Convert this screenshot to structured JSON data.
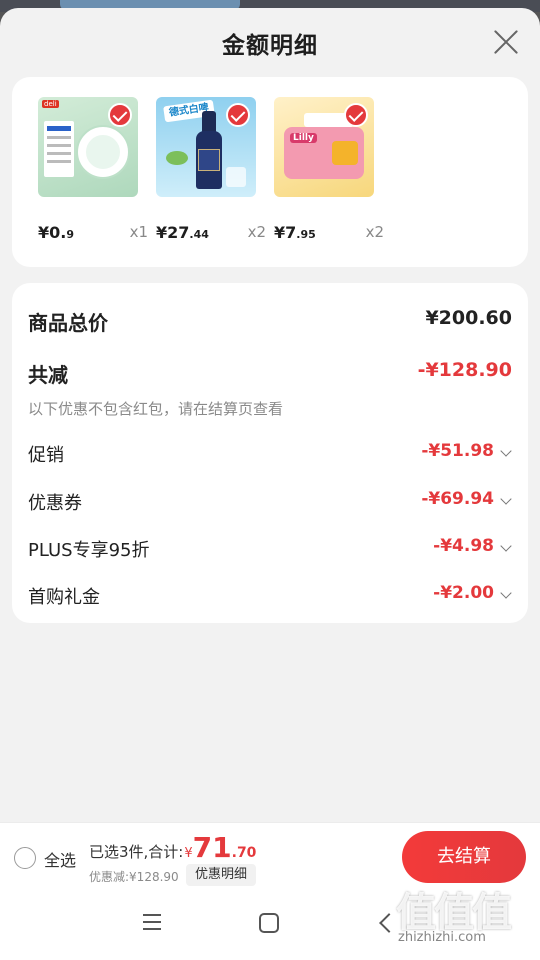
{
  "sheet": {
    "title": "金额明细"
  },
  "products": [
    {
      "price_main": "¥0.",
      "price_dec": "9",
      "qty": "x1",
      "thumb_text": "deli",
      "name": "tape"
    },
    {
      "price_main": "¥27",
      "price_dec": ".44",
      "qty": "x2",
      "thumb_text": "德式白啤",
      "name": "beer"
    },
    {
      "price_main": "¥7",
      "price_dec": ".95",
      "qty": "x2",
      "thumb_text": "Lilly",
      "name": "snack"
    }
  ],
  "details": {
    "total_label": "商品总价",
    "total_value": "¥200.60",
    "reduce_label": "共减",
    "reduce_value": "-¥128.90",
    "reduce_note": "以下优惠不包含红包，请在结算页查看",
    "items": [
      {
        "label": "促销",
        "value": "-¥51.98"
      },
      {
        "label": "优惠券",
        "value": "-¥69.94"
      },
      {
        "label": "PLUS专享95折",
        "value": "-¥4.98"
      },
      {
        "label": "首购礼金",
        "value": "-¥2.00"
      }
    ]
  },
  "bottom_bar": {
    "select_all": "全选",
    "count_text": "已选3件,合计:",
    "currency": "¥",
    "total_int": "71",
    "total_dec": ".70",
    "saved_text": "优惠减:¥128.90",
    "detail_chip": "优惠明细",
    "checkout": "去结算"
  },
  "watermark": {
    "glyphs": "值值值",
    "url": "zhizhizhi.com"
  },
  "colors": {
    "accent": "#e4393c",
    "background": "#f2f2f2"
  }
}
